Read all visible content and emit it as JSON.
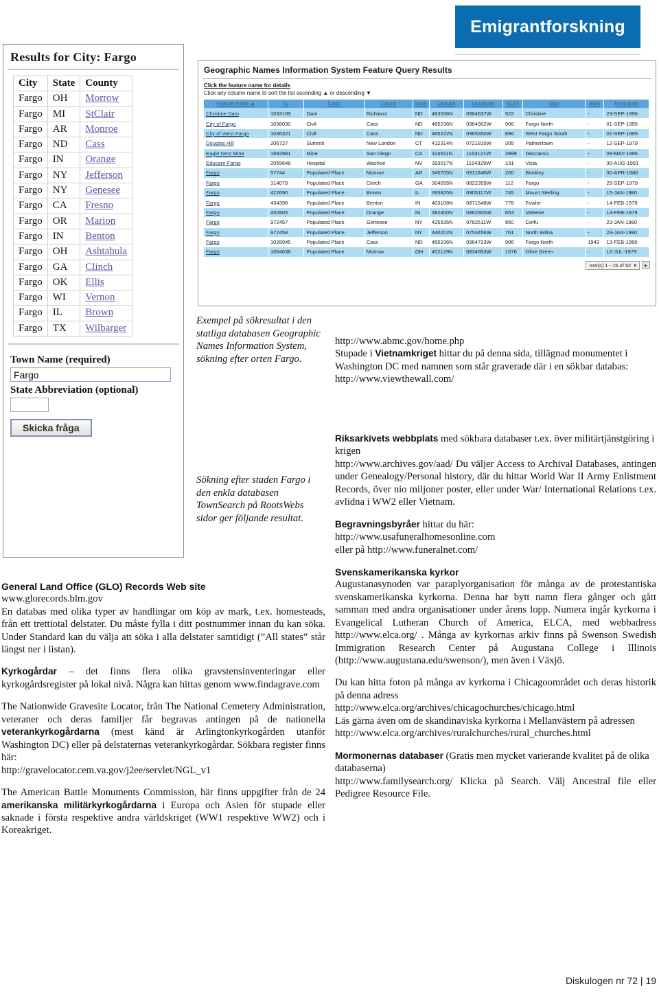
{
  "banner": {
    "title": "Emigrantforskning"
  },
  "townsearch": {
    "title": "Results for City: Fargo",
    "columns": [
      "City",
      "State",
      "County"
    ],
    "rows": [
      [
        "Fargo",
        "OH",
        "Morrow"
      ],
      [
        "Fargo",
        "MI",
        "StClair"
      ],
      [
        "Fargo",
        "AR",
        "Monroe"
      ],
      [
        "Fargo",
        "ND",
        "Cass"
      ],
      [
        "Fargo",
        "IN",
        "Orange"
      ],
      [
        "Fargo",
        "NY",
        "Jefferson"
      ],
      [
        "Fargo",
        "NY",
        "Genesee"
      ],
      [
        "Fargo",
        "CA",
        "Fresno"
      ],
      [
        "Fargo",
        "OR",
        "Marion"
      ],
      [
        "Fargo",
        "IN",
        "Benton"
      ],
      [
        "Fargo",
        "OH",
        "Ashtabula"
      ],
      [
        "Fargo",
        "GA",
        "Clinch"
      ],
      [
        "Fargo",
        "OK",
        "Ellis"
      ],
      [
        "Fargo",
        "WI",
        "Vernon"
      ],
      [
        "Fargo",
        "IL",
        "Brown"
      ],
      [
        "Fargo",
        "TX",
        "Wilbarger"
      ]
    ],
    "form": {
      "town_label": "Town Name (required)",
      "town_value": "Fargo",
      "state_label": "State Abbreviation (optional)",
      "state_value": "",
      "submit_label": "Skicka fråga"
    }
  },
  "gnis": {
    "title": "Geographic Names Information System Feature Query Results",
    "hint_bold": "Click the feature name for details",
    "hint": "Click any column name to sort the list ascending ▲ or descending ▼",
    "columns": [
      "Feature Name ▲",
      "ID",
      "Class",
      "County",
      "State",
      "Latitude",
      "Longitude",
      "ELEV",
      "Map",
      "BGN",
      "Entry Date"
    ],
    "rows": [
      [
        "Christine Dam",
        "1033199",
        "Dam",
        "Richland",
        "ND",
        "463536N",
        "0964637W",
        "922",
        "Christine",
        "-",
        "23-SEP-1996"
      ],
      [
        "City of Fargo",
        "1036030",
        "Civil",
        "Cass",
        "ND",
        "465236N",
        "0964902W",
        "906",
        "Fargo North",
        "-",
        "01-SEP-1995"
      ],
      [
        "City of West Fargo",
        "1036321",
        "Civil",
        "Cass",
        "ND",
        "465222N",
        "0965350W",
        "896",
        "West Fargo South",
        "-",
        "01-SEP-1995"
      ],
      [
        "Douglas Hill",
        "206727",
        "Summit",
        "New London",
        "CT",
        "412314N",
        "0721810W",
        "305",
        "Palmertown",
        "-",
        "12-SEP-1979"
      ],
      [
        "Eagle Nest Mine",
        "1692981",
        "Mine",
        "San Diego",
        "CA",
        "324511N",
        "1163121W",
        "3999",
        "Descanso",
        "-",
        "08-MAY-1996"
      ],
      [
        "Educare-Fargo",
        "2059648",
        "Hospital",
        "Washoe",
        "NV",
        "393017N",
        "1194329W",
        "131",
        "Vista",
        "-",
        "30-AUG-1991"
      ],
      [
        "Fargo",
        "57744",
        "Populated Place",
        "Monroe",
        "AR",
        "345705N",
        "0911048W",
        "200",
        "Brinkley",
        "-",
        "30-APR-1980"
      ],
      [
        "Fargo",
        "314079",
        "Populated Place",
        "Clinch",
        "GA",
        "304055N",
        "0822359W",
        "112",
        "Fargo",
        "-",
        "25-SEP-1979"
      ],
      [
        "Fargo",
        "422690",
        "Populated Place",
        "Brown",
        "IL",
        "395825N",
        "0905117W",
        "745",
        "Mount Sterling",
        "-",
        "15-JAN-1980"
      ],
      [
        "Fargo",
        "434398",
        "Populated Place",
        "Benton",
        "IN",
        "403108N",
        "0871648W",
        "778",
        "Fowler",
        "-",
        "14-FEB-1979"
      ],
      [
        "Fargo",
        "450905",
        "Populated Place",
        "Orange",
        "IN",
        "382400N",
        "0862900W",
        "653",
        "Valeene",
        "-",
        "14-FEB-1979"
      ],
      [
        "Fargo",
        "972457",
        "Populated Place",
        "Genesee",
        "NY",
        "425535N",
        "0782611W",
        "860",
        "Corfu",
        "-",
        "23-JAN-1980"
      ],
      [
        "Fargo",
        "972458",
        "Populated Place",
        "Jefferson",
        "NY",
        "440202N",
        "0753456W",
        "761",
        "North Wilna",
        "-",
        "23-JAN-1980"
      ],
      [
        "Fargo",
        "1028945",
        "Populated Place",
        "Cass",
        "ND",
        "465236N",
        "0964723W",
        "906",
        "Fargo North",
        "1943",
        "13-FEB-1980"
      ],
      [
        "Fargo",
        "1064638",
        "Populated Place",
        "Morrow",
        "OH",
        "402129N",
        "0834953W",
        "1076",
        "Olive Green",
        "-",
        "12-JUL-1979"
      ]
    ],
    "footer_label": "row(s) 1 - 15 of 92"
  },
  "captions": {
    "gnis": "Exempel på sökresultat i den statliga databasen Geographic Names Information System, sökning efter orten Fargo.",
    "townsearch": "Sökning efter staden Fargo i den enkla databasen TownSearch på RootsWebs sidor ger följande resultat."
  },
  "left_column": {
    "glo_heading": "General Land Office (GLO) Records Web site",
    "glo_url": "www.glorecords.blm.gov",
    "glo_body": "En databas med olika typer av handlingar om köp av mark, t.ex. homesteads, från ett trettiotal delstater. Du måste fylla i ditt postnummer innan du kan söka. Under Standard kan du välja att söka i alla delstater samtidigt (”All states” står längst ner i listan).",
    "kyrkogardar_bold": "Kyrkogårdar",
    "kyrkogardar_body": " – det finns flera olika gravstensinventeringar eller kyrkogårdsregister på lokal nivå. Några kan hittas genom www.findagrave.com",
    "gravesite_1": "The Nationwide Gravesite Locator, från The National Cemetery Administration, veteraner och deras familjer får begravas antingen på de nationella ",
    "gravesite_bold": "veterankyrkogårdarna",
    "gravesite_2": " (mest känd är Arlingtonkyrkogården utanför Washington DC) eller på delstaternas veterankyrkogårdar. Sökbara register finns här:",
    "gravesite_url": "http://gravelocator.cem.va.gov/j2ee/servlet/NGL_v1",
    "abmc_1": "The American Battle Monuments Commission, här finns uppgifter från de 24 ",
    "abmc_bold": "amerikanska militärkyrkogårdarna",
    "abmc_2": " i Europa och Asien för stupade eller saknade i första respektive andra världskriget (WW1 respektive WW2) och i Koreakriget."
  },
  "right_column": {
    "abmc_url": "http://www.abmc.gov/home.php",
    "vietnam_1": "Stupade i ",
    "vietnam_bold": "Vietnamkriget",
    "vietnam_2": " hittar du på denna sida, tillägnad monumentet i Washington DC med namnen som står graverade där i en sökbar databas:",
    "vietnam_url": "http://www.viewthewall.com/",
    "riksarkivet_bold": "Riksarkivets webbplats",
    "riksarkivet_1": " med sökbara databaser t.ex. över militärtjänstgöring i krigen",
    "riksarkivet_2": "http://www.archives.gov/aad/  Du väljer Access to Archival Databases, antingen under Genealogy/Personal history, där du hittar World War II Army Enlistment Records, över nio miljoner poster, eller under War/ International Relations t.ex. avlidna i WW2 eller Vietnam.",
    "begravning_bold": "Begravningsbyråer",
    "begravning_1": " hittar du här:",
    "begravning_url1": "http://www.usafuneralhomesonline.com",
    "begravning_url2": "eller på http://www.funeralnet.com/",
    "kyrkor_heading": "Svenskamerikanska kyrkor",
    "kyrkor_body": "Augustanasynoden var paraplyorganisation för många av de protestantiska svenskamerikanska kyrkorna. Denna har bytt namn flera gånger och gått samman med andra organisationer under årens lopp. Numera ingår kyrkorna i Evangelical Lutheran Church of America, ELCA, med webbadress http://www.elca.org/ . Många av kyrkornas arkiv finns på Swenson Swedish Immigration Research Center på Augustana College i Illinois (http://www.augustana.edu/swenson/), men även i Växjö.",
    "chicago_body_1": "Du kan hitta foton på många av kyrkorna i Chicagoområdet och deras historik på denna adress",
    "chicago_url_1": "http://www.elca.org/archives/chicagochurches/chicago.html",
    "chicago_body_2": "Läs gärna även om de skandinaviska kyrkorna i Mellanvästern på adressen",
    "chicago_url_2": "http://www.elca.org/archives/ruralchurches/rural_churches.html",
    "mormon_bold": "Mormonernas databaser",
    "mormon_1": " (Gratis men mycket varierande kvalitet på de olika databaserna)",
    "mormon_2": "http://www.familysearch.org/ Klicka på Search. Välj Ancestral file eller Pedigree Resource File."
  },
  "footer": {
    "text": "Diskulogen nr 72 | 19"
  },
  "colors": {
    "banner_bg": "#0b6cb0",
    "gnis_header": "#5aa6dc",
    "gnis_row_alt": "#addcf3",
    "link": "#6a4fa3"
  }
}
